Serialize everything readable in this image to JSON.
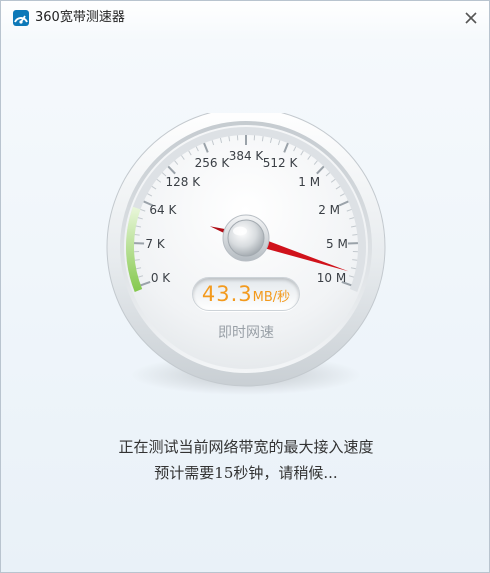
{
  "window": {
    "title": "360宽带测速器",
    "app_icon": "360-speedometer-icon",
    "close_icon": "close-icon"
  },
  "gauge": {
    "tick_labels": [
      "0 K",
      "7 K",
      "64 K",
      "128 K",
      "256 K",
      "384 K",
      "512 K",
      "1 M",
      "2 M",
      "5 M",
      "10 M"
    ],
    "speed_value": "43.3",
    "speed_unit": "MB/秒",
    "realtime_label": "即时网速",
    "needle_position": "10 M",
    "progress_fraction": 0.18,
    "accent_color": "#f39a1d",
    "needle_color": "#d0121b",
    "progress_color": "#8ccf5c"
  },
  "status": {
    "line1": "正在测试当前网络带宽的最大接入速度",
    "line2": "预计需要15秒钟，请稍候..."
  }
}
